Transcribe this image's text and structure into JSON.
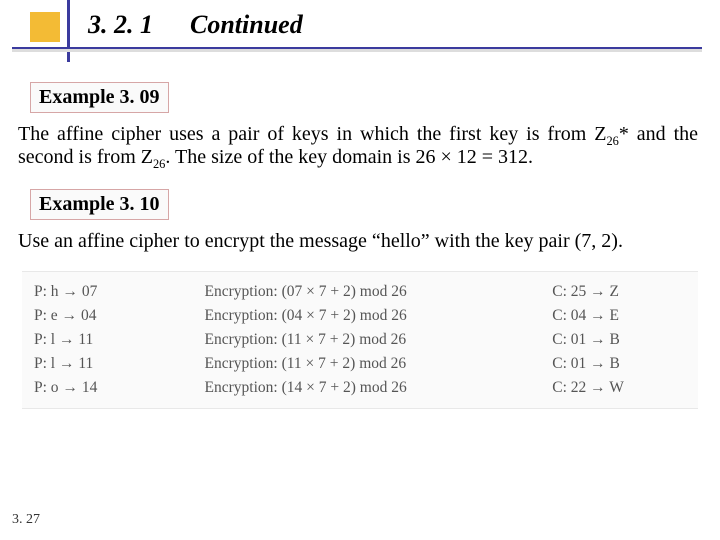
{
  "header": {
    "section_num": "3. 2. 1",
    "title": "Continued"
  },
  "example1": {
    "label": "Example 3. 09",
    "text_pre": "The affine cipher uses a pair of keys in which the first key is from Z",
    "sub1": "26",
    "text_mid1": "* and the second is from Z",
    "sub2": "26",
    "text_post": ". The size of the key domain is 26 × 12 = 312."
  },
  "example2": {
    "label": "Example 3. 10",
    "text": "Use an affine cipher to encrypt the message “hello” with the key pair (7, 2)."
  },
  "table": {
    "rows": [
      {
        "p_l": "P: h",
        "p_v": "07",
        "enc": "Encryption: (07 × 7 + 2) mod 26",
        "c_v": "C: 25",
        "c_l": "Z"
      },
      {
        "p_l": "P: e",
        "p_v": "04",
        "enc": "Encryption: (04 × 7 + 2) mod 26",
        "c_v": "C: 04",
        "c_l": "E"
      },
      {
        "p_l": "P: l",
        "p_v": "11",
        "enc": "Encryption: (11 × 7 + 2) mod 26",
        "c_v": "C: 01",
        "c_l": "B"
      },
      {
        "p_l": "P: l",
        "p_v": "11",
        "enc": "Encryption: (11 × 7 + 2) mod 26",
        "c_v": "C: 01",
        "c_l": "B"
      },
      {
        "p_l": "P: o",
        "p_v": "14",
        "enc": "Encryption: (14 × 7 + 2) mod 26",
        "c_v": "C: 22",
        "c_l": "W"
      }
    ]
  },
  "page_number": "3. 27"
}
